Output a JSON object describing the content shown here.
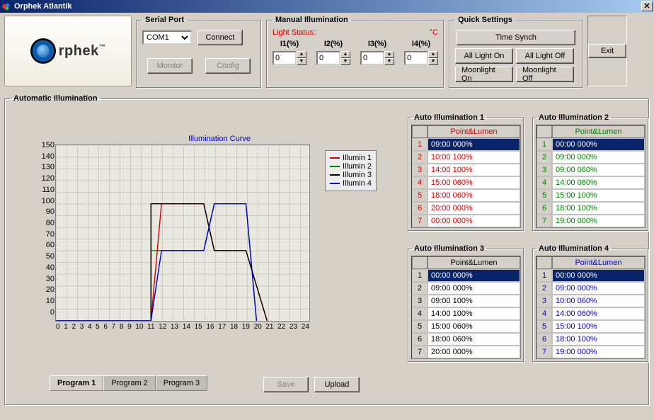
{
  "window": {
    "title": "Orphek Atlantik",
    "close_glyph": "✕"
  },
  "logo": {
    "text": "rphek",
    "tm": "™"
  },
  "serial_port": {
    "legend": "Serial Port",
    "selected": "COM1",
    "connect": "Connect",
    "monitor": "Monitor",
    "config": "Config"
  },
  "manual": {
    "legend": "Manual Illumination",
    "status_label": "Light Status:",
    "temp_unit": "°C",
    "cols": [
      "I1(%)",
      "I2(%)",
      "I3(%)",
      "I4(%)"
    ],
    "values": [
      "0",
      "0",
      "0",
      "0"
    ]
  },
  "quick": {
    "legend": "Quick Settings",
    "time_synch": "Time Synch",
    "all_on": "All Light On",
    "all_off": "All Light Off",
    "moon_on": "Moonlight On",
    "moon_off": "Moonlight Off"
  },
  "exit": {
    "label": "Exit"
  },
  "auto": {
    "legend": "Automatic Illumination"
  },
  "chart_data": {
    "type": "line",
    "title": "Illumination Curve",
    "xlabel": "",
    "ylabel": "",
    "xlim": [
      0,
      24
    ],
    "ylim": [
      0,
      150
    ],
    "x_ticks": [
      0,
      1,
      2,
      3,
      4,
      5,
      6,
      7,
      8,
      9,
      10,
      11,
      12,
      13,
      14,
      15,
      16,
      17,
      18,
      19,
      20,
      21,
      22,
      23,
      24
    ],
    "y_ticks": [
      0,
      10,
      20,
      30,
      40,
      50,
      60,
      70,
      80,
      90,
      100,
      110,
      120,
      130,
      140,
      150
    ],
    "legend": [
      "Illumin 1",
      "Illumin 2",
      "Illumin 3",
      "Illumin 4"
    ],
    "colors": [
      "#d00000",
      "#008000",
      "#000000",
      "#0000d0"
    ],
    "series": [
      {
        "name": "Illumin 1",
        "points": [
          [
            9,
            0
          ],
          [
            10,
            100
          ],
          [
            14,
            100
          ],
          [
            15,
            60
          ],
          [
            18,
            60
          ],
          [
            20,
            0
          ]
        ]
      },
      {
        "name": "Illumin 2",
        "points": [
          [
            0,
            0
          ],
          [
            9,
            0
          ],
          [
            9,
            60
          ],
          [
            14,
            60
          ],
          [
            15,
            100
          ],
          [
            18,
            100
          ],
          [
            19,
            0
          ]
        ]
      },
      {
        "name": "Illumin 3",
        "points": [
          [
            0,
            0
          ],
          [
            9,
            0
          ],
          [
            9,
            100
          ],
          [
            14,
            100
          ],
          [
            15,
            60
          ],
          [
            18,
            60
          ],
          [
            20,
            0
          ]
        ]
      },
      {
        "name": "Illumin 4",
        "points": [
          [
            0,
            0
          ],
          [
            9,
            0
          ],
          [
            10,
            60
          ],
          [
            14,
            60
          ],
          [
            15,
            100
          ],
          [
            18,
            100
          ],
          [
            19,
            0
          ]
        ]
      }
    ]
  },
  "tabs": {
    "items": [
      "Program 1",
      "Program 2",
      "Program 3"
    ],
    "active": 0
  },
  "buttons": {
    "save": "Save",
    "upload": "Upload"
  },
  "tables": [
    {
      "legend": "Auto Illumination 1",
      "header": "Point&Lumen",
      "color": "c-red",
      "selected": 0,
      "rows": [
        [
          "1",
          "09:00  000%"
        ],
        [
          "2",
          "10:00  100%"
        ],
        [
          "3",
          "14:00  100%"
        ],
        [
          "4",
          "15:00  060%"
        ],
        [
          "5",
          "18:00  060%"
        ],
        [
          "6",
          "20:00  000%"
        ],
        [
          "7",
          "00:00  000%"
        ]
      ]
    },
    {
      "legend": "Auto Illumination 2",
      "header": "Point&Lumen",
      "color": "c-green",
      "selected": 0,
      "rows": [
        [
          "1",
          "00:00  000%"
        ],
        [
          "2",
          "09:00  000%"
        ],
        [
          "3",
          "09:00  060%"
        ],
        [
          "4",
          "14:00  060%"
        ],
        [
          "5",
          "15:00  100%"
        ],
        [
          "6",
          "18:00  100%"
        ],
        [
          "7",
          "19:00  000%"
        ]
      ]
    },
    {
      "legend": "Auto Illumination 3",
      "header": "Point&Lumen",
      "color": "c-black",
      "selected": 0,
      "rows": [
        [
          "1",
          "00:00  000%"
        ],
        [
          "2",
          "09:00  000%"
        ],
        [
          "3",
          "09:00  100%"
        ],
        [
          "4",
          "14:00  100%"
        ],
        [
          "5",
          "15:00  060%"
        ],
        [
          "6",
          "18:00  060%"
        ],
        [
          "7",
          "20:00  000%"
        ]
      ]
    },
    {
      "legend": "Auto Illumination 4",
      "header": "Point&Lumen",
      "color": "c-blue",
      "selected": 0,
      "rows": [
        [
          "1",
          "00:00  000%"
        ],
        [
          "2",
          "09:00  000%"
        ],
        [
          "3",
          "10:00  060%"
        ],
        [
          "4",
          "14:00  060%"
        ],
        [
          "5",
          "15:00  100%"
        ],
        [
          "6",
          "18:00  100%"
        ],
        [
          "7",
          "19:00  000%"
        ]
      ]
    }
  ]
}
